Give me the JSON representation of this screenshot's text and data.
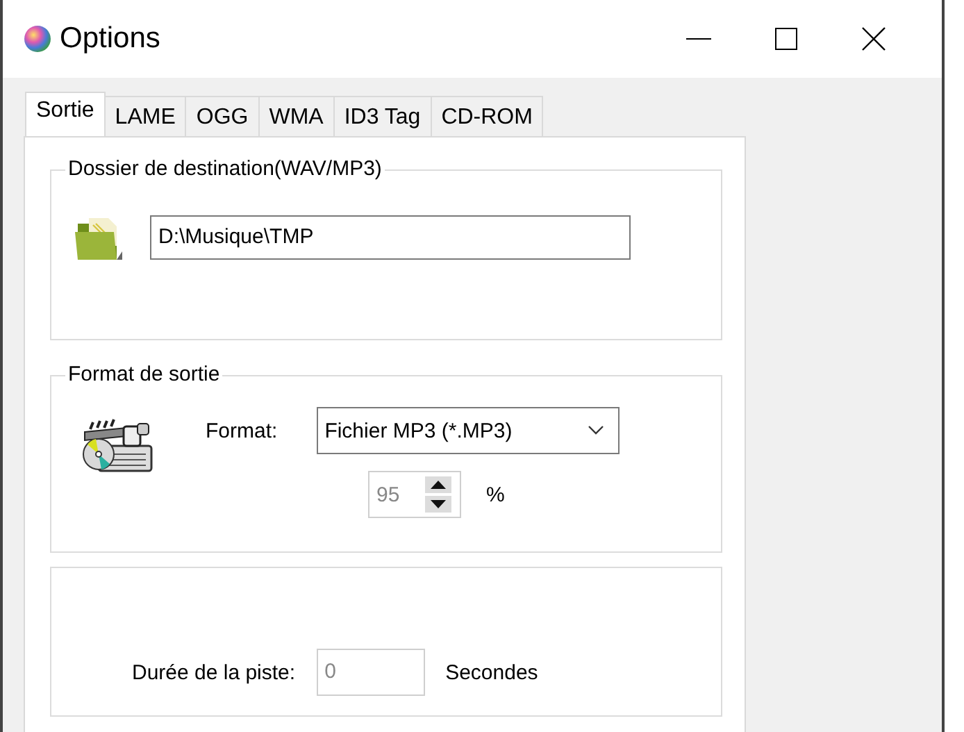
{
  "window": {
    "title": "Options"
  },
  "tabs": [
    {
      "label": "Sortie",
      "selected": true
    },
    {
      "label": "LAME",
      "selected": false
    },
    {
      "label": "OGG",
      "selected": false
    },
    {
      "label": "WMA",
      "selected": false
    },
    {
      "label": "ID3 Tag",
      "selected": false
    },
    {
      "label": "CD-ROM",
      "selected": false
    }
  ],
  "destination": {
    "legend": "Dossier de destination(WAV/MP3)",
    "value": "D:\\Musique\\TMP"
  },
  "output_format": {
    "legend": "Format de sortie",
    "format_label": "Format:",
    "format_value": "Fichier MP3 (*.MP3)",
    "quality": {
      "value": "95",
      "disabled": true
    },
    "unit": "%"
  },
  "track": {
    "label": "Durée de la piste:",
    "value": "0",
    "disabled": true,
    "unit": "Secondes"
  }
}
